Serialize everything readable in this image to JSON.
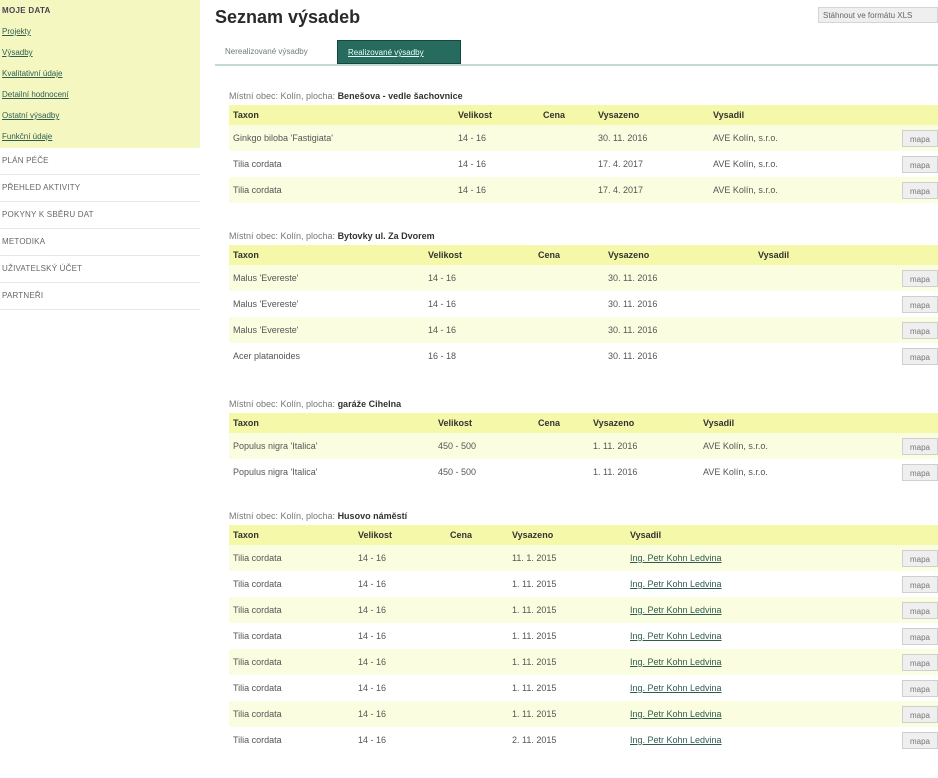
{
  "sidebar": {
    "title": "MOJE DATA",
    "links": [
      "Projekty",
      "Výsadby",
      "Kvalitativní údaje",
      "Detailní hodnocení",
      "Ostatní výsadby",
      "Funkční údaje"
    ],
    "items": [
      "PLÁN PÉČE",
      "PŘEHLED AKTIVITY",
      "POKYNY K SBĚRU DAT",
      "METODIKA",
      "UŽIVATELSKÝ ÚČET",
      "PARTNEŘI"
    ]
  },
  "header": {
    "title": "Seznam výsadeb",
    "download_label": "Stáhnout ve formátu XLS"
  },
  "tabs": {
    "planned": "Nerealizované výsadby",
    "done": "Realizované výsadby"
  },
  "columns": {
    "taxon": "Taxon",
    "size": "Velikost",
    "price": "Cena",
    "planted": "Vysazeno",
    "planter": "Vysadil"
  },
  "map_label": "mapa",
  "sections": [
    {
      "locality_prefix": "Místní obec: Kolín, plocha:",
      "locality_name": "Benešova - vedle šachovnice",
      "rows": [
        {
          "taxon": "Ginkgo biloba 'Fastigiata'",
          "size": "14 - 16",
          "price": "",
          "planted": "30. 11. 2016",
          "planter": "AVE Kolín, s.r.o."
        },
        {
          "taxon": "Tilia cordata",
          "size": "14 - 16",
          "price": "",
          "planted": "17. 4. 2017",
          "planter": "AVE Kolín, s.r.o."
        },
        {
          "taxon": "Tilia cordata",
          "size": "14 - 16",
          "price": "",
          "planted": "17. 4. 2017",
          "planter": "AVE Kolín, s.r.o."
        }
      ]
    },
    {
      "locality_prefix": "Místní obec: Kolín, plocha:",
      "locality_name": "Bytovky ul. Za Dvorem",
      "rows": [
        {
          "taxon": "Malus 'Evereste'",
          "size": "14 - 16",
          "price": "",
          "planted": "30. 11. 2016",
          "planter": ""
        },
        {
          "taxon": "Malus 'Evereste'",
          "size": "14 - 16",
          "price": "",
          "planted": "30. 11. 2016",
          "planter": ""
        },
        {
          "taxon": "Malus 'Evereste'",
          "size": "14 - 16",
          "price": "",
          "planted": "30. 11. 2016",
          "planter": ""
        },
        {
          "taxon": "Acer platanoides",
          "size": "16 - 18",
          "price": "",
          "planted": "30. 11. 2016",
          "planter": ""
        }
      ]
    },
    {
      "locality_prefix": "Místní obec: Kolín, plocha:",
      "locality_name": "garáže Cihelna",
      "rows": [
        {
          "taxon": "Populus nigra 'Italica'",
          "size": "450 - 500",
          "price": "",
          "planted": "1. 11. 2016",
          "planter": "AVE Kolín, s.r.o."
        },
        {
          "taxon": "Populus nigra 'Italica'",
          "size": "450 - 500",
          "price": "",
          "planted": "1. 11. 2016",
          "planter": "AVE Kolín, s.r.o."
        }
      ]
    },
    {
      "locality_prefix": "Místní obec: Kolín, plocha:",
      "locality_name": "Husovo náměstí",
      "rows": [
        {
          "taxon": "Tilia cordata",
          "size": "14 - 16",
          "price": "",
          "planted": "11. 1. 2015",
          "planter": "Ing. Petr Kohn Ledvina"
        },
        {
          "taxon": "Tilia cordata",
          "size": "14 - 16",
          "price": "",
          "planted": "1. 11. 2015",
          "planter": "Ing. Petr Kohn Ledvina"
        },
        {
          "taxon": "Tilia cordata",
          "size": "14 - 16",
          "price": "",
          "planted": "1. 11. 2015",
          "planter": "Ing. Petr Kohn Ledvina"
        },
        {
          "taxon": "Tilia cordata",
          "size": "14 - 16",
          "price": "",
          "planted": "1. 11. 2015",
          "planter": "Ing. Petr Kohn Ledvina"
        },
        {
          "taxon": "Tilia cordata",
          "size": "14 - 16",
          "price": "",
          "planted": "1. 11. 2015",
          "planter": "Ing. Petr Kohn Ledvina"
        },
        {
          "taxon": "Tilia cordata",
          "size": "14 - 16",
          "price": "",
          "planted": "1. 11. 2015",
          "planter": "Ing. Petr Kohn Ledvina"
        },
        {
          "taxon": "Tilia cordata",
          "size": "14 - 16",
          "price": "",
          "planted": "1. 11. 2015",
          "planter": "Ing. Petr Kohn Ledvina"
        },
        {
          "taxon": "Tilia cordata",
          "size": "14 - 16",
          "price": "",
          "planted": "2. 11. 2015",
          "planter": "Ing. Petr Kohn Ledvina"
        }
      ]
    }
  ]
}
